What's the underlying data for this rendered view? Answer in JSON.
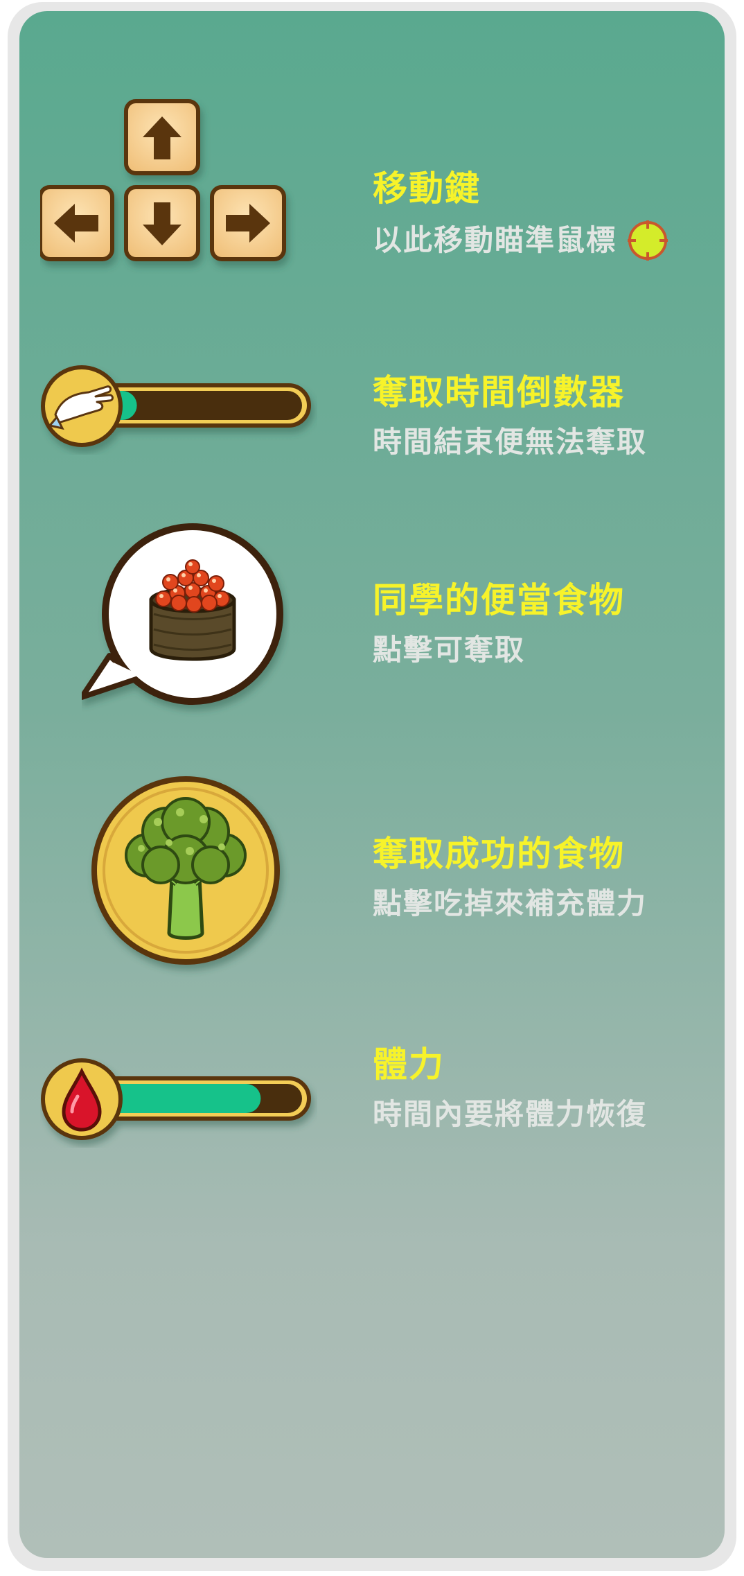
{
  "tutorial": {
    "items": [
      {
        "id": "move-keys",
        "title": "移動鍵",
        "desc": "以此移動瞄準鼠標",
        "icon": "arrow-keys-icon"
      },
      {
        "id": "grab-timer",
        "title": "奪取時間倒數器",
        "desc": "時間結束便無法奪取",
        "icon": "grab-hand-icon",
        "progress": 0.04
      },
      {
        "id": "classmate-food",
        "title": "同學的便當食物",
        "desc": "點擊可奪取",
        "icon": "ikura-sushi-bubble-icon"
      },
      {
        "id": "grabbed-food",
        "title": "奪取成功的食物",
        "desc": "點擊吃掉來補充體力",
        "icon": "broccoli-coin-icon"
      },
      {
        "id": "stamina",
        "title": "體力",
        "desc": "時間內要將體力恢復",
        "icon": "blood-drop-icon",
        "progress": 0.8
      }
    ]
  },
  "colors": {
    "title": "#f7f32a",
    "desc": "#e2e6e3",
    "bar_fill": "#13c28a",
    "bar_track": "#4a2e0f",
    "coin": "#efc94d",
    "key": "#f6d49a"
  }
}
